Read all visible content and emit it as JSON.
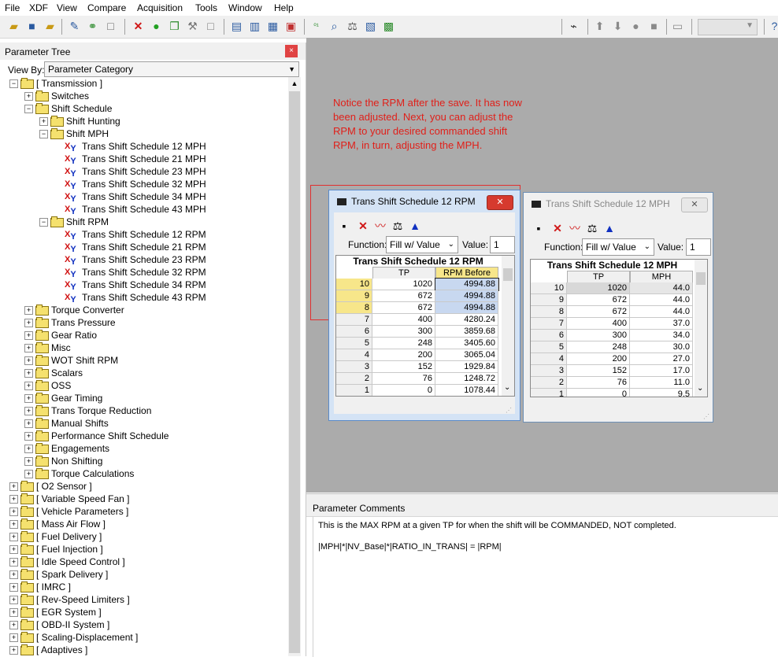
{
  "menu": [
    "File",
    "XDF",
    "View",
    "Compare",
    "Acquisition",
    "Tools",
    "Window",
    "Help"
  ],
  "toolbar_icons": [
    "open-folder-icon",
    "save-icon",
    "save-all-icon",
    "edit-icon",
    "link-icon",
    "new-page-icon",
    "delete-icon",
    "add-icon",
    "copy-icon",
    "wrench-icon",
    "page-icon",
    "table-view-icon",
    "split-view-icon",
    "calendar-icon",
    "chart-icon",
    "binary-icon",
    "search-icon",
    "compare-icon",
    "layout-icon",
    "calculator-icon",
    "probe-icon",
    "arrow-up-icon",
    "arrow-down-icon",
    "record-icon",
    "stack-icon",
    "chip-icon"
  ],
  "parameter_tree": {
    "title": "Parameter Tree",
    "close": "×",
    "view_by_label": "View By:",
    "view_by_value": "Parameter Category",
    "items": [
      {
        "label": "[ Transmission ]",
        "level": 0,
        "type": "folder",
        "open": true
      },
      {
        "label": "Switches",
        "level": 1,
        "type": "folder"
      },
      {
        "label": "Shift Schedule",
        "level": 1,
        "type": "folder",
        "open": true
      },
      {
        "label": "Shift Hunting",
        "level": 2,
        "type": "folder"
      },
      {
        "label": "Shift MPH",
        "level": 2,
        "type": "folder",
        "open": true
      },
      {
        "label": "Trans Shift Schedule 12 MPH",
        "level": 3,
        "type": "table"
      },
      {
        "label": "Trans Shift Schedule 21 MPH",
        "level": 3,
        "type": "table"
      },
      {
        "label": "Trans Shift Schedule 23 MPH",
        "level": 3,
        "type": "table"
      },
      {
        "label": "Trans Shift Schedule 32 MPH",
        "level": 3,
        "type": "table"
      },
      {
        "label": "Trans Shift Schedule 34 MPH",
        "level": 3,
        "type": "table"
      },
      {
        "label": "Trans Shift Schedule 43 MPH",
        "level": 3,
        "type": "table"
      },
      {
        "label": "Shift RPM",
        "level": 2,
        "type": "folder",
        "open": true
      },
      {
        "label": "Trans Shift Schedule 12 RPM",
        "level": 3,
        "type": "table",
        "selected": true
      },
      {
        "label": "Trans Shift Schedule 21 RPM",
        "level": 3,
        "type": "table"
      },
      {
        "label": "Trans Shift Schedule 23 RPM",
        "level": 3,
        "type": "table"
      },
      {
        "label": "Trans Shift Schedule 32 RPM",
        "level": 3,
        "type": "table"
      },
      {
        "label": "Trans Shift Schedule 34 RPM",
        "level": 3,
        "type": "table"
      },
      {
        "label": "Trans Shift Schedule 43 RPM",
        "level": 3,
        "type": "table"
      },
      {
        "label": "Torque Converter",
        "level": 1,
        "type": "folder"
      },
      {
        "label": "Trans Pressure",
        "level": 1,
        "type": "folder"
      },
      {
        "label": "Gear Ratio",
        "level": 1,
        "type": "folder"
      },
      {
        "label": "Misc",
        "level": 1,
        "type": "folder"
      },
      {
        "label": "WOT Shift RPM",
        "level": 1,
        "type": "folder"
      },
      {
        "label": "Scalars",
        "level": 1,
        "type": "folder"
      },
      {
        "label": "OSS",
        "level": 1,
        "type": "folder"
      },
      {
        "label": "Gear Timing",
        "level": 1,
        "type": "folder"
      },
      {
        "label": "Trans Torque Reduction",
        "level": 1,
        "type": "folder"
      },
      {
        "label": "Manual Shifts",
        "level": 1,
        "type": "folder"
      },
      {
        "label": "Performance Shift Schedule",
        "level": 1,
        "type": "folder"
      },
      {
        "label": "Engagements",
        "level": 1,
        "type": "folder"
      },
      {
        "label": "Non Shifting",
        "level": 1,
        "type": "folder"
      },
      {
        "label": "Torque Calculations",
        "level": 1,
        "type": "folder"
      },
      {
        "label": "[ O2 Sensor ]",
        "level": 0,
        "type": "folder"
      },
      {
        "label": "[ Variable Speed Fan ]",
        "level": 0,
        "type": "folder"
      },
      {
        "label": "[ Vehicle Parameters ]",
        "level": 0,
        "type": "folder"
      },
      {
        "label": "[ Mass Air Flow ]",
        "level": 0,
        "type": "folder"
      },
      {
        "label": "[ Fuel Delivery ]",
        "level": 0,
        "type": "folder"
      },
      {
        "label": "[ Fuel Injection ]",
        "level": 0,
        "type": "folder"
      },
      {
        "label": "[ Idle Speed Control ]",
        "level": 0,
        "type": "folder"
      },
      {
        "label": "[ Spark Delivery ]",
        "level": 0,
        "type": "folder"
      },
      {
        "label": "[ IMRC ]",
        "level": 0,
        "type": "folder"
      },
      {
        "label": "[ Rev-Speed Limiters ]",
        "level": 0,
        "type": "folder"
      },
      {
        "label": "[ EGR System ]",
        "level": 0,
        "type": "folder"
      },
      {
        "label": "[ OBD-II System ]",
        "level": 0,
        "type": "folder"
      },
      {
        "label": "[ Scaling-Displacement ]",
        "level": 0,
        "type": "folder"
      },
      {
        "label": "[ Adaptives ]",
        "level": 0,
        "type": "folder"
      }
    ]
  },
  "annotation": "Notice the RPM after the save. It has now been adjusted. Next, you can adjust the RPM to your desired commanded shift RPM, in turn, adjusting the MPH.",
  "rpm_window": {
    "title": "Trans Shift Schedule 12 RPM",
    "function_label": "Function:",
    "function_value": "Fill w/ Value",
    "value_label": "Value:",
    "value": "1",
    "grid_title": "Trans Shift Schedule 12 RPM",
    "col_headers": [
      "TP",
      "RPM Before"
    ],
    "rows": [
      {
        "idx": "10",
        "tp": "1020",
        "val": "4994.88",
        "hl": true
      },
      {
        "idx": "9",
        "tp": "672",
        "val": "4994.88",
        "hl": true
      },
      {
        "idx": "8",
        "tp": "672",
        "val": "4994.88",
        "hl": true
      },
      {
        "idx": "7",
        "tp": "400",
        "val": "4280.24"
      },
      {
        "idx": "6",
        "tp": "300",
        "val": "3859.68"
      },
      {
        "idx": "5",
        "tp": "248",
        "val": "3405.60"
      },
      {
        "idx": "4",
        "tp": "200",
        "val": "3065.04"
      },
      {
        "idx": "3",
        "tp": "152",
        "val": "1929.84"
      },
      {
        "idx": "2",
        "tp": "76",
        "val": "1248.72"
      },
      {
        "idx": "1",
        "tp": "0",
        "val": "1078.44"
      }
    ]
  },
  "mph_window": {
    "title": "Trans Shift Schedule 12 MPH",
    "function_label": "Function:",
    "function_value": "Fill w/ Value",
    "value_label": "Value:",
    "value": "1",
    "grid_title": "Trans Shift Schedule 12 MPH",
    "col_headers": [
      "TP",
      "MPH"
    ],
    "rows": [
      {
        "idx": "10",
        "tp": "1020",
        "val": "44.0"
      },
      {
        "idx": "9",
        "tp": "672",
        "val": "44.0"
      },
      {
        "idx": "8",
        "tp": "672",
        "val": "44.0"
      },
      {
        "idx": "7",
        "tp": "400",
        "val": "37.0"
      },
      {
        "idx": "6",
        "tp": "300",
        "val": "34.0"
      },
      {
        "idx": "5",
        "tp": "248",
        "val": "30.0"
      },
      {
        "idx": "4",
        "tp": "200",
        "val": "27.0"
      },
      {
        "idx": "3",
        "tp": "152",
        "val": "17.0"
      },
      {
        "idx": "2",
        "tp": "76",
        "val": "11.0"
      },
      {
        "idx": "1",
        "tp": "0",
        "val": "9.5"
      }
    ]
  },
  "comments": {
    "title": "Parameter Comments",
    "line1": "This is the MAX RPM at a given TP for when the shift will be COMMANDED, NOT completed.",
    "line2": "|MPH|*|NV_Base|*|RATIO_IN_TRANS| = |RPM|"
  }
}
